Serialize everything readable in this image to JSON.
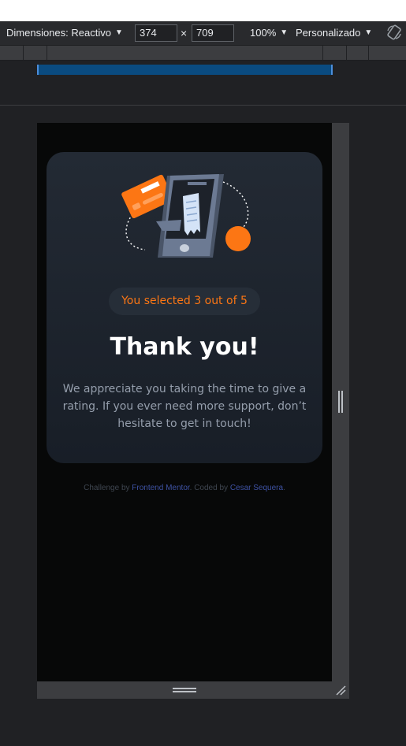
{
  "devtools": {
    "dimensions_label": "Dimensiones: Reactivo",
    "width_value": "374",
    "times": "×",
    "height_value": "709",
    "zoom": "100%",
    "throttle": "Personalizado"
  },
  "card": {
    "badge_prefix": "You selected ",
    "badge_rating": "3",
    "badge_middle": " out of ",
    "badge_max": "5",
    "title": "Thank you!",
    "message": "We appreciate you taking the time to give a rating. If you ever need more support, don’t hesitate to get in touch!"
  },
  "attribution": {
    "prefix": "Challenge by ",
    "link1": "Frontend Mentor",
    "middle": ". Coded by ",
    "link2": "Cesar Sequera",
    "suffix": "."
  },
  "colors": {
    "accent": "#fc7614",
    "card_top": "#232a34",
    "card_bottom": "#181e27",
    "link": "#3e52a3",
    "media_bar": "#0a4b80"
  },
  "icons": {
    "dimensions_caret": "caret-down-icon",
    "rotate": "rotate-icon",
    "illustration": "thank-you-illustration"
  }
}
